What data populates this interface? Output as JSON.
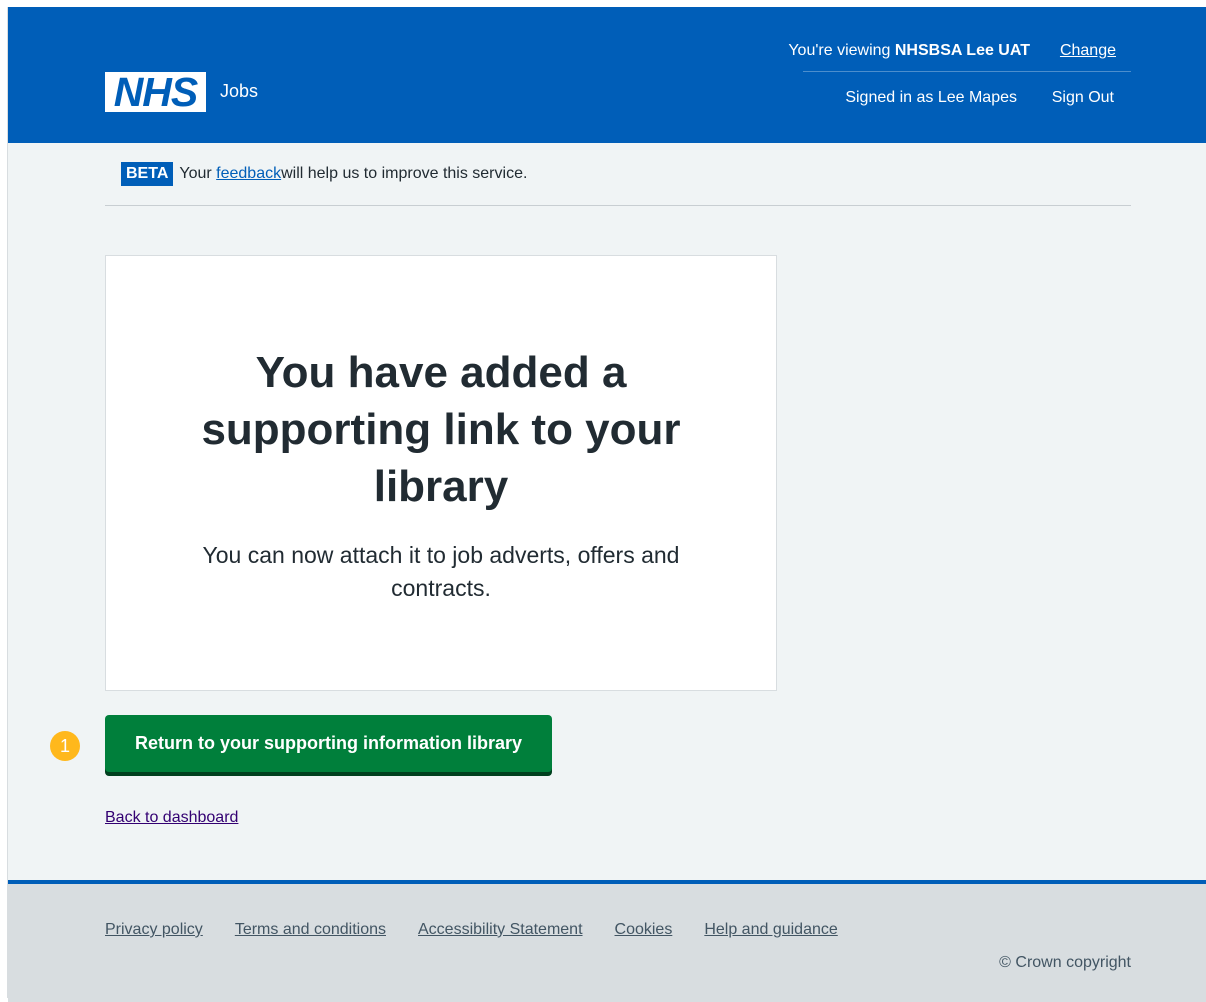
{
  "header": {
    "logo_text": "NHS",
    "service_name": "Jobs",
    "viewing_prefix": "You're viewing ",
    "viewing_org": "NHSBSA Lee UAT",
    "change_label": "Change",
    "signed_in": "Signed in as Lee Mapes",
    "sign_out": "Sign Out"
  },
  "beta": {
    "tag": "BETA",
    "text_before": "Your ",
    "link": "feedback",
    "text_after": " will help us to improve this service."
  },
  "panel": {
    "title": "You have added a supporting link to your library",
    "body": "You can now attach it to job adverts, offers and contracts."
  },
  "step_badge": "1",
  "primary_button": "Return to your supporting information library",
  "back_link": "Back to dashboard",
  "footer": {
    "links": [
      "Privacy policy",
      "Terms and conditions",
      "Accessibility Statement",
      "Cookies",
      "Help and guidance"
    ],
    "copyright": "© Crown copyright"
  },
  "colors": {
    "nhs_blue": "#005eb8",
    "button_green": "#007f3b",
    "badge_yellow": "#ffb81c",
    "page_bg": "#f0f4f5"
  }
}
